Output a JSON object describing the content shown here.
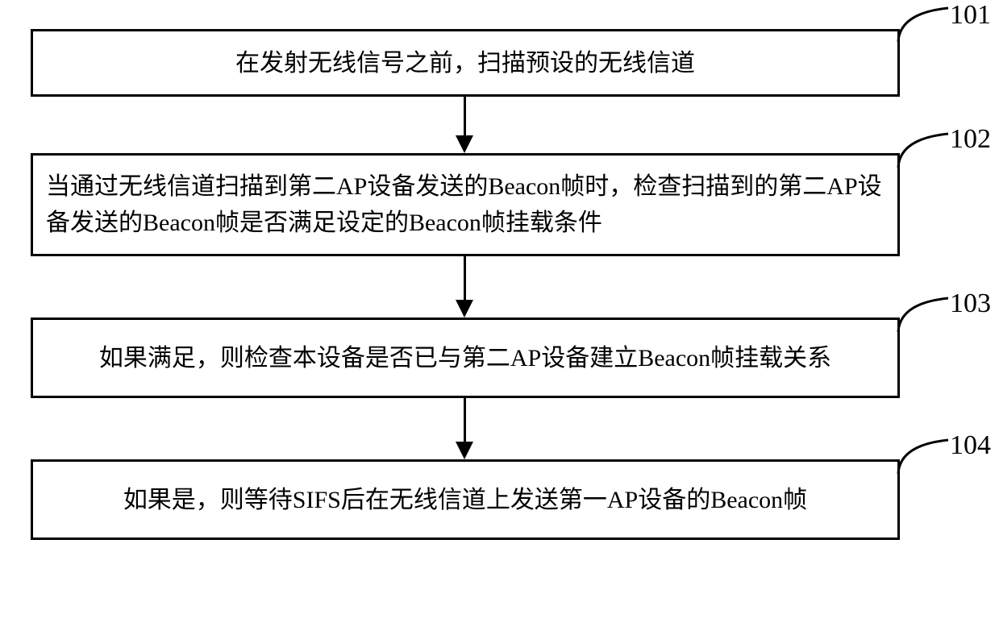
{
  "steps": [
    {
      "id": "101",
      "text": "在发射无线信号之前，扫描预设的无线信道"
    },
    {
      "id": "102",
      "text": "当通过无线信道扫描到第二AP设备发送的Beacon帧时，检查扫描到的第二AP设备发送的Beacon帧是否满足设定的Beacon帧挂载条件"
    },
    {
      "id": "103",
      "text": "如果满足，则检查本设备是否已与第二AP设备建立Beacon帧挂载关系"
    },
    {
      "id": "104",
      "text": "如果是，则等待SIFS后在无线信道上发送第一AP设备的Beacon帧"
    }
  ]
}
